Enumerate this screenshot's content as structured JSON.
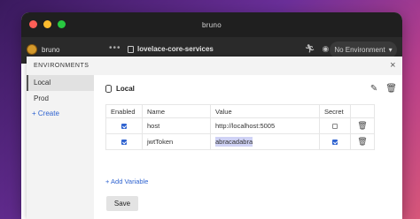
{
  "window": {
    "title": "bruno"
  },
  "toolbar": {
    "app_name": "bruno",
    "more_label": "•••",
    "collection_name": "lovelace-core-services",
    "environment_select": "No Environment"
  },
  "modal": {
    "title": "ENVIRONMENTS",
    "close": "×",
    "sidebar": {
      "items": [
        {
          "label": "Local",
          "active": true
        },
        {
          "label": "Prod",
          "active": false
        }
      ],
      "create_label": "+ Create"
    },
    "env_title": "Local",
    "table": {
      "headers": [
        "Enabled",
        "Name",
        "Value",
        "Secret",
        ""
      ],
      "rows": [
        {
          "enabled": true,
          "name": "host",
          "value": "http://localhost:5005",
          "secret": false
        },
        {
          "enabled": true,
          "name": "jwtToken",
          "value": "abracadabra",
          "secret": true
        }
      ]
    },
    "add_variable": "+ Add Variable",
    "save_label": "Save"
  },
  "colors": {
    "accent": "#2f63d0",
    "titlebar": "#1f1f1f",
    "toolbar": "#2a2a2a",
    "selection": "#cfd2f5"
  },
  "icons": [
    "dog-logo-icon",
    "collection-icon",
    "runner-icon",
    "eye-icon",
    "chevron-down-icon",
    "database-icon",
    "edit-icon",
    "trash-icon",
    "close-icon"
  ]
}
